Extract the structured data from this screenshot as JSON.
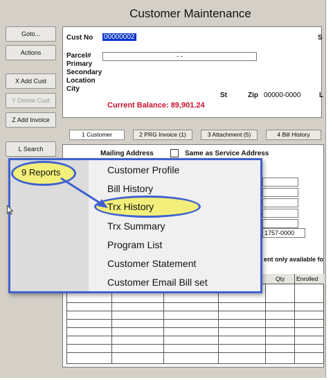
{
  "window": {
    "title": "Customer Maintenance"
  },
  "sidebar": {
    "buttons": [
      {
        "label": "Goto...",
        "disabled": false
      },
      {
        "label": "Actions",
        "disabled": false
      },
      {
        "label": "X Add Cust",
        "disabled": false
      },
      {
        "label": "Y Delete Cust",
        "disabled": true
      },
      {
        "label": "Z Add Invoice",
        "disabled": false
      },
      {
        "label": "L Search",
        "disabled": false
      },
      {
        "label": "9 Reports",
        "disabled": false
      }
    ]
  },
  "header": {
    "cust_no_label": "Cust No",
    "cust_no_value": "00000002",
    "parcel_label": "Parcel#",
    "parcel_value": "    -        -",
    "primary_label": "Primary",
    "secondary_label": "Secondary",
    "location_label": "Location",
    "city_label": "City",
    "st_label": "St",
    "zip_label": "Zip",
    "zip_value": "00000-0000",
    "balance": "Current Balance: 89,901.24",
    "right_s": "S",
    "right_l": "L"
  },
  "tabs": [
    {
      "label": "1 Customer",
      "active": true
    },
    {
      "label": "2 PRG Invoice (1)",
      "active": false
    },
    {
      "label": "3 Attachment (5)",
      "active": false
    },
    {
      "label": "4 Bill History",
      "active": false
    }
  ],
  "mailing": {
    "label": "Mailing Address",
    "same_label": "Same as Service Address",
    "zip_value": "1757-0000",
    "enrollment_note": "ent only available fo",
    "table_headers": [
      "Qty",
      "Enrolled"
    ]
  },
  "menu": {
    "items": [
      "Customer Profile",
      "Bill History",
      "Trx History",
      "Trx Summary",
      "Program List",
      "Customer Statement",
      "Customer Email Bill set"
    ],
    "highlighted": "Trx History"
  },
  "colors": {
    "accent": "#3f61cf",
    "highlight": "#f3ef7a",
    "balance_red": "#c8102e",
    "selection_blue": "#0a36c8"
  }
}
